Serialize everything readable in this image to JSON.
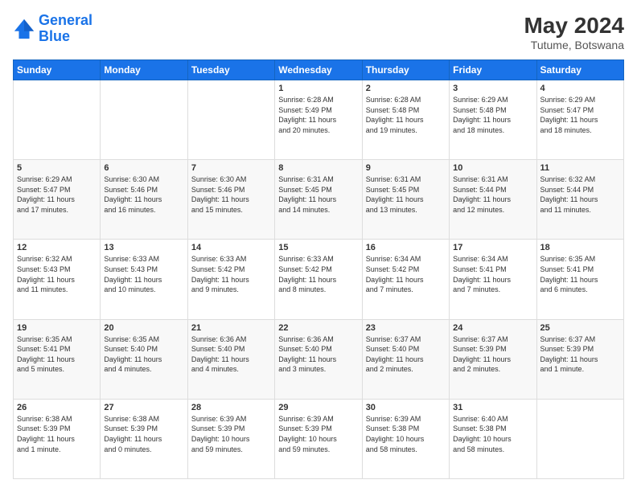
{
  "logo": {
    "line1": "General",
    "line2": "Blue"
  },
  "title": "May 2024",
  "location": "Tutume, Botswana",
  "days_of_week": [
    "Sunday",
    "Monday",
    "Tuesday",
    "Wednesday",
    "Thursday",
    "Friday",
    "Saturday"
  ],
  "weeks": [
    [
      {
        "day": "",
        "info": ""
      },
      {
        "day": "",
        "info": ""
      },
      {
        "day": "",
        "info": ""
      },
      {
        "day": "1",
        "info": "Sunrise: 6:28 AM\nSunset: 5:49 PM\nDaylight: 11 hours\nand 20 minutes."
      },
      {
        "day": "2",
        "info": "Sunrise: 6:28 AM\nSunset: 5:48 PM\nDaylight: 11 hours\nand 19 minutes."
      },
      {
        "day": "3",
        "info": "Sunrise: 6:29 AM\nSunset: 5:48 PM\nDaylight: 11 hours\nand 18 minutes."
      },
      {
        "day": "4",
        "info": "Sunrise: 6:29 AM\nSunset: 5:47 PM\nDaylight: 11 hours\nand 18 minutes."
      }
    ],
    [
      {
        "day": "5",
        "info": "Sunrise: 6:29 AM\nSunset: 5:47 PM\nDaylight: 11 hours\nand 17 minutes."
      },
      {
        "day": "6",
        "info": "Sunrise: 6:30 AM\nSunset: 5:46 PM\nDaylight: 11 hours\nand 16 minutes."
      },
      {
        "day": "7",
        "info": "Sunrise: 6:30 AM\nSunset: 5:46 PM\nDaylight: 11 hours\nand 15 minutes."
      },
      {
        "day": "8",
        "info": "Sunrise: 6:31 AM\nSunset: 5:45 PM\nDaylight: 11 hours\nand 14 minutes."
      },
      {
        "day": "9",
        "info": "Sunrise: 6:31 AM\nSunset: 5:45 PM\nDaylight: 11 hours\nand 13 minutes."
      },
      {
        "day": "10",
        "info": "Sunrise: 6:31 AM\nSunset: 5:44 PM\nDaylight: 11 hours\nand 12 minutes."
      },
      {
        "day": "11",
        "info": "Sunrise: 6:32 AM\nSunset: 5:44 PM\nDaylight: 11 hours\nand 11 minutes."
      }
    ],
    [
      {
        "day": "12",
        "info": "Sunrise: 6:32 AM\nSunset: 5:43 PM\nDaylight: 11 hours\nand 11 minutes."
      },
      {
        "day": "13",
        "info": "Sunrise: 6:33 AM\nSunset: 5:43 PM\nDaylight: 11 hours\nand 10 minutes."
      },
      {
        "day": "14",
        "info": "Sunrise: 6:33 AM\nSunset: 5:42 PM\nDaylight: 11 hours\nand 9 minutes."
      },
      {
        "day": "15",
        "info": "Sunrise: 6:33 AM\nSunset: 5:42 PM\nDaylight: 11 hours\nand 8 minutes."
      },
      {
        "day": "16",
        "info": "Sunrise: 6:34 AM\nSunset: 5:42 PM\nDaylight: 11 hours\nand 7 minutes."
      },
      {
        "day": "17",
        "info": "Sunrise: 6:34 AM\nSunset: 5:41 PM\nDaylight: 11 hours\nand 7 minutes."
      },
      {
        "day": "18",
        "info": "Sunrise: 6:35 AM\nSunset: 5:41 PM\nDaylight: 11 hours\nand 6 minutes."
      }
    ],
    [
      {
        "day": "19",
        "info": "Sunrise: 6:35 AM\nSunset: 5:41 PM\nDaylight: 11 hours\nand 5 minutes."
      },
      {
        "day": "20",
        "info": "Sunrise: 6:35 AM\nSunset: 5:40 PM\nDaylight: 11 hours\nand 4 minutes."
      },
      {
        "day": "21",
        "info": "Sunrise: 6:36 AM\nSunset: 5:40 PM\nDaylight: 11 hours\nand 4 minutes."
      },
      {
        "day": "22",
        "info": "Sunrise: 6:36 AM\nSunset: 5:40 PM\nDaylight: 11 hours\nand 3 minutes."
      },
      {
        "day": "23",
        "info": "Sunrise: 6:37 AM\nSunset: 5:40 PM\nDaylight: 11 hours\nand 2 minutes."
      },
      {
        "day": "24",
        "info": "Sunrise: 6:37 AM\nSunset: 5:39 PM\nDaylight: 11 hours\nand 2 minutes."
      },
      {
        "day": "25",
        "info": "Sunrise: 6:37 AM\nSunset: 5:39 PM\nDaylight: 11 hours\nand 1 minute."
      }
    ],
    [
      {
        "day": "26",
        "info": "Sunrise: 6:38 AM\nSunset: 5:39 PM\nDaylight: 11 hours\nand 1 minute."
      },
      {
        "day": "27",
        "info": "Sunrise: 6:38 AM\nSunset: 5:39 PM\nDaylight: 11 hours\nand 0 minutes."
      },
      {
        "day": "28",
        "info": "Sunrise: 6:39 AM\nSunset: 5:39 PM\nDaylight: 10 hours\nand 59 minutes."
      },
      {
        "day": "29",
        "info": "Sunrise: 6:39 AM\nSunset: 5:39 PM\nDaylight: 10 hours\nand 59 minutes."
      },
      {
        "day": "30",
        "info": "Sunrise: 6:39 AM\nSunset: 5:38 PM\nDaylight: 10 hours\nand 58 minutes."
      },
      {
        "day": "31",
        "info": "Sunrise: 6:40 AM\nSunset: 5:38 PM\nDaylight: 10 hours\nand 58 minutes."
      },
      {
        "day": "",
        "info": ""
      }
    ]
  ]
}
